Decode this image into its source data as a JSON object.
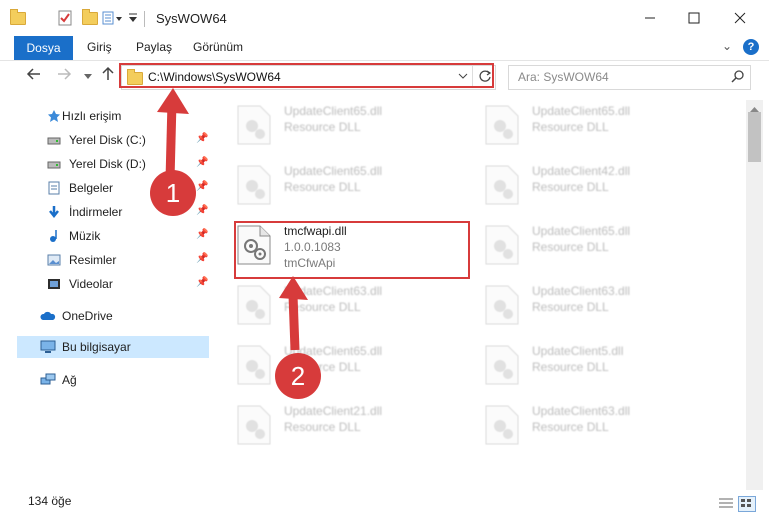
{
  "window": {
    "title": "SysWOW64"
  },
  "ribbon": {
    "tabs": [
      "Dosya",
      "Giriş",
      "Paylaş",
      "Görünüm"
    ]
  },
  "address": {
    "path": "C:\\Windows\\SysWOW64",
    "search_placeholder": "Ara: SysWOW64"
  },
  "nav": {
    "items": [
      {
        "label": "Hızlı erişim",
        "icon": "star-icon"
      },
      {
        "label": "Yerel Disk (C:)",
        "icon": "drive-icon",
        "pinned": true
      },
      {
        "label": "Yerel Disk (D:)",
        "icon": "drive-icon",
        "pinned": true
      },
      {
        "label": "Belgeler",
        "icon": "document-icon",
        "pinned": true
      },
      {
        "label": "İndirmeler",
        "icon": "download-icon",
        "pinned": true
      },
      {
        "label": "Müzik",
        "icon": "music-icon",
        "pinned": true
      },
      {
        "label": "Resimler",
        "icon": "pictures-icon",
        "pinned": true
      },
      {
        "label": "Videolar",
        "icon": "video-icon",
        "pinned": true
      },
      {
        "label": "OneDrive",
        "icon": "cloud-icon"
      },
      {
        "label": "Bu bilgisayar",
        "icon": "computer-icon",
        "selected": true
      },
      {
        "label": "Ağ",
        "icon": "network-icon"
      }
    ]
  },
  "files": [
    {
      "name": "UpdateClient65.dll",
      "desc": "Resource DLL",
      "faded": true
    },
    {
      "name": "UpdateClient65.dll",
      "desc": "Resource DLL",
      "faded": true
    },
    {
      "name": "UpdateClient65.dll",
      "desc": "Resource DLL",
      "faded": true
    },
    {
      "name": "UpdateClient42.dll",
      "desc": "Resource DLL",
      "faded": true
    },
    {
      "name": "tmcfwapi.dll",
      "version": "1.0.0.1083",
      "desc": "tmCfwApi",
      "faded": false
    },
    {
      "name": "UpdateClient65.dll",
      "desc": "Resource DLL",
      "faded": true
    },
    {
      "name": "UpdateClient63.dll",
      "desc": "Resource DLL",
      "faded": true
    },
    {
      "name": "UpdateClient63.dll",
      "desc": "Resource DLL",
      "faded": true
    },
    {
      "name": "UpdateClient65.dll",
      "desc": "Resource DLL",
      "faded": true
    },
    {
      "name": "UpdateClient5.dll",
      "desc": "Resource DLL",
      "faded": true
    },
    {
      "name": "UpdateClient21.dll",
      "desc": "Resource DLL",
      "faded": true
    },
    {
      "name": "UpdateClient63.dll",
      "desc": "Resource DLL",
      "faded": true
    }
  ],
  "status": {
    "count": "134 öğe"
  },
  "annotations": {
    "step1": "1",
    "step2": "2",
    "color": "#d73b3b"
  }
}
